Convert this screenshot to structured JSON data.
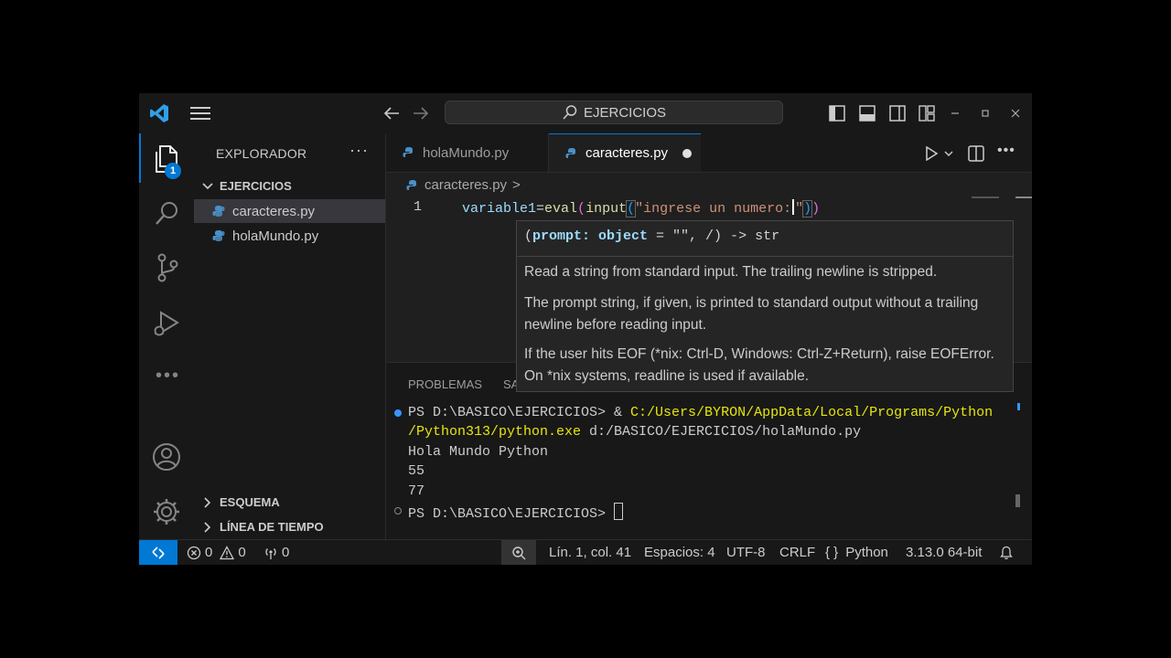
{
  "titlebar": {
    "search_text": "EJERCICIOS"
  },
  "activity": {
    "explorer_badge": "1"
  },
  "sidebar": {
    "title": "EXPLORADOR",
    "more": "···",
    "folder": "EJERCICIOS",
    "files": [
      {
        "label": "caracteres.py"
      },
      {
        "label": "holaMundo.py"
      }
    ],
    "outline": "ESQUEMA",
    "timeline": "LÍNEA DE TIEMPO"
  },
  "tabs": [
    {
      "label": "holaMundo.py"
    },
    {
      "label": "caracteres.py"
    }
  ],
  "breadcrumb": {
    "file": "caracteres.py",
    "sep": ">"
  },
  "editor": {
    "line_number": "1",
    "code": {
      "var": "variable1",
      "eq": "=",
      "fn1": "eval",
      "fn2": "input",
      "open1": "(",
      "open2": "(",
      "str_a": "\"ingrese un numero:",
      "str_b": "\"",
      "close2": ")",
      "close1": ")"
    }
  },
  "hover": {
    "signature_open": "(",
    "signature_param": "prompt: object",
    "signature_rest": " = \"\", /) -> str",
    "p1": "Read a string from standard input. The trailing newline is stripped.",
    "p2": "The prompt string, if given, is printed to standard output without a trailing newline before reading input.",
    "p3": "If the user hits EOF (*nix: Ctrl-D, Windows: Ctrl-Z+Return), raise EOFError. On *nix systems, readline is used if available."
  },
  "panel": {
    "tabs": [
      "PROBLEMAS",
      "SA"
    ],
    "terminal": {
      "l1_prompt": "PS D:\\BASICO\\EJERCICIOS> & ",
      "l1_path": "C:/Users/BYRON/AppData/Local/Programs/Python",
      "l2_path": "/Python313/python.exe",
      "l2_rest": " d:/BASICO/EJERCICIOS/holaMundo.py",
      "l3": "Hola Mundo Python",
      "l4": "55",
      "l5": "77",
      "l6": "PS D:\\BASICO\\EJERCICIOS> "
    }
  },
  "status": {
    "errors": "0",
    "warnings": "0",
    "ports": "0",
    "position": "Lín. 1, col. 41",
    "spaces": "Espacios: 4",
    "encoding": "UTF-8",
    "eol": "CRLF",
    "lang_brace": "{ }",
    "language": "Python",
    "interpreter": "3.13.0 64-bit"
  },
  "colors": {
    "accent": "#0078d4",
    "background": "#1f1f1f",
    "chrome": "#181818"
  }
}
